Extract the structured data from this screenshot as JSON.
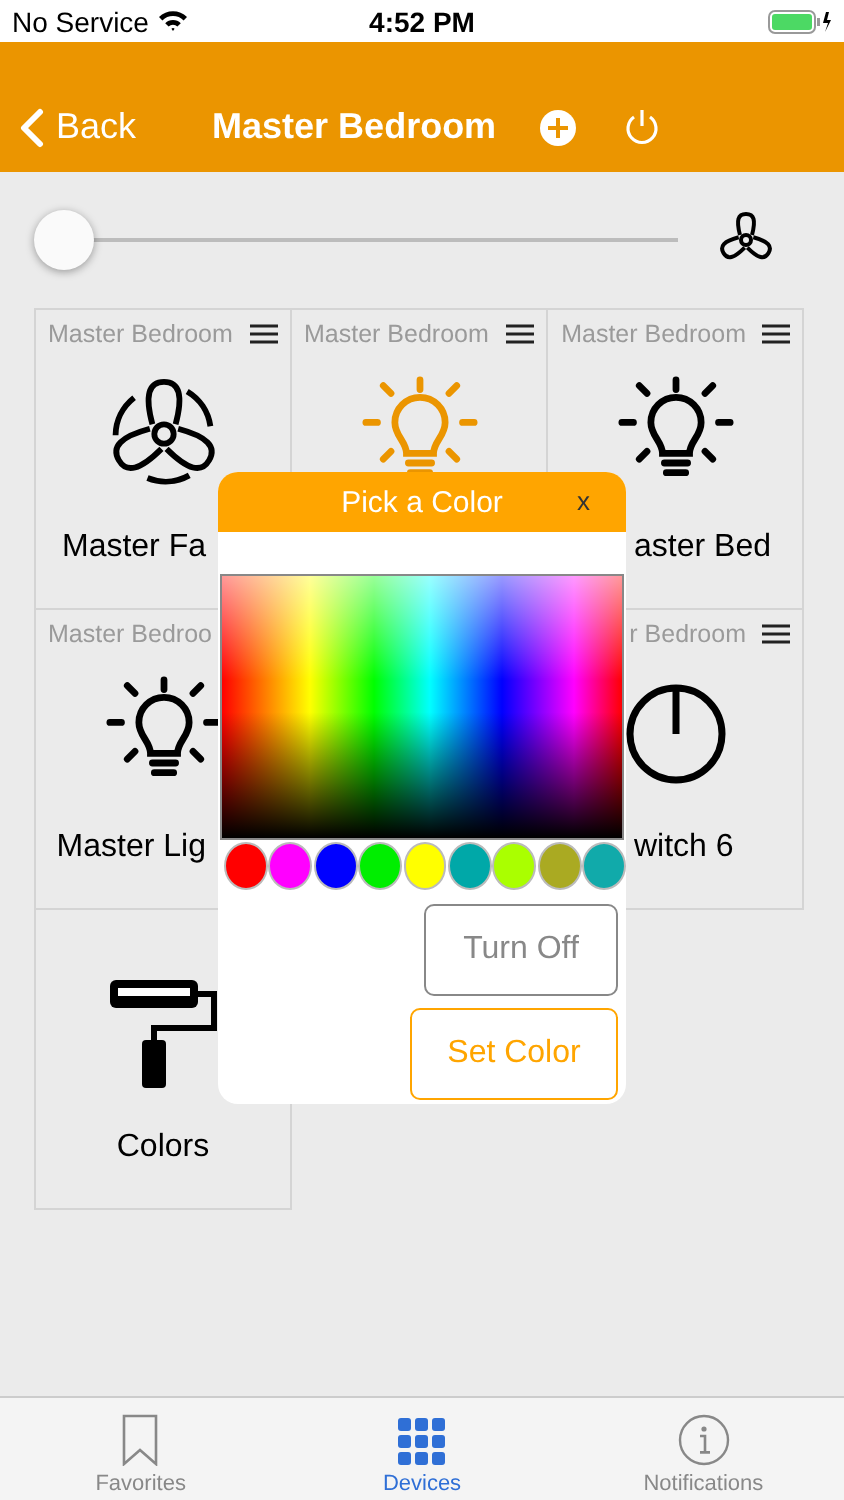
{
  "status_bar": {
    "carrier": "No Service",
    "time": "4:52 PM"
  },
  "nav": {
    "back": "Back",
    "title": "Master Bedroom"
  },
  "master_slider": {
    "level": 0
  },
  "devices": [
    {
      "header": "Master Bedroom",
      "menu_icon": true,
      "kind": "fan",
      "label": "Master Fa"
    },
    {
      "header": "Master Bedroom",
      "menu_icon": true,
      "kind": "light",
      "on": true
    },
    {
      "header": "Master Bedroom",
      "menu_icon": true,
      "kind": "light",
      "on": false,
      "label": "aster Bed"
    },
    {
      "header": "Master Bedroo",
      "menu_icon": false,
      "kind": "light",
      "on": false,
      "label": "Master Lig"
    },
    {
      "header": "r Bedroom",
      "menu_icon": true,
      "kind": "switch",
      "label": "witch 6"
    },
    {
      "kind": "scene",
      "label": "Colors"
    }
  ],
  "color_dialog": {
    "title": "Pick a Color",
    "close": "x",
    "swatches": [
      {
        "color": "#ff0000"
      },
      {
        "color": "#ff00ff"
      },
      {
        "color": "#0000ff"
      },
      {
        "color": "#00ee00"
      },
      {
        "color": "#ffff00"
      },
      {
        "color": "#00a8a8"
      },
      {
        "color": "#aaff00"
      },
      {
        "color": "#aaaa22"
      },
      {
        "color": "#11aaaa"
      }
    ],
    "buttons": [
      {
        "label": "Turn Off",
        "kind": "secondary"
      },
      {
        "label": "Set Color",
        "kind": "primary"
      }
    ]
  },
  "tabs": [
    {
      "label": "Favorites",
      "selected": false
    },
    {
      "label": "Devices",
      "selected": true
    },
    {
      "label": "Notifications",
      "selected": false
    }
  ]
}
